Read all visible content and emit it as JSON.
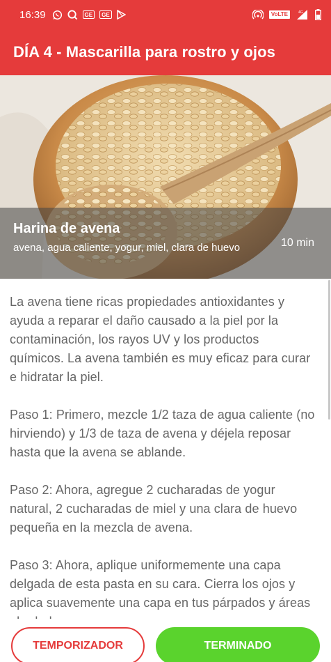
{
  "status_bar": {
    "time": "16:39",
    "left_icons": [
      "whatsapp-icon",
      "search-icon",
      "ge-icon",
      "ge-icon",
      "play-store-icon"
    ],
    "ge_label": "GE",
    "volte": "VoLTE",
    "network": "4G",
    "right_icons": [
      "hotspot-icon",
      "volte-icon",
      "signal-icon",
      "battery-icon"
    ]
  },
  "app_bar": {
    "title": "DÍA 4 - Mascarilla para rostro y ojos"
  },
  "hero": {
    "title": "Harina de avena",
    "ingredients": "avena, agua caliente, yogur, miel, clara de huevo",
    "duration": "10 min",
    "image": "oats-bowl-spoon"
  },
  "content": {
    "intro": "La avena tiene ricas propiedades antioxidantes y ayuda a reparar el daño causado a la piel por la contaminación, los rayos UV y los productos químicos. La avena también es muy eficaz para curar e hidratar la piel.",
    "step1": "Paso 1: Primero, mezcle 1/2 taza de agua caliente (no hirviendo) y 1/3 de taza de avena y déjela reposar hasta que la avena se ablande.",
    "step2": "Paso 2: Ahora, agregue 2 cucharadas de yogur natural, 2 cucharadas de miel y una clara de huevo pequeña en la mezcla de avena.",
    "step3": "Paso 3: Ahora, aplique uniformemente una capa delgada de esta pasta en su cara. Cierra los ojos y aplica suavemente una capa en tus párpados y áreas alrededor."
  },
  "buttons": {
    "timer": "TEMPORIZADOR",
    "done": "TERMINADO"
  },
  "colors": {
    "primary_red": "#e53b3b",
    "done_green": "#5ad32d",
    "body_text": "#666666"
  }
}
